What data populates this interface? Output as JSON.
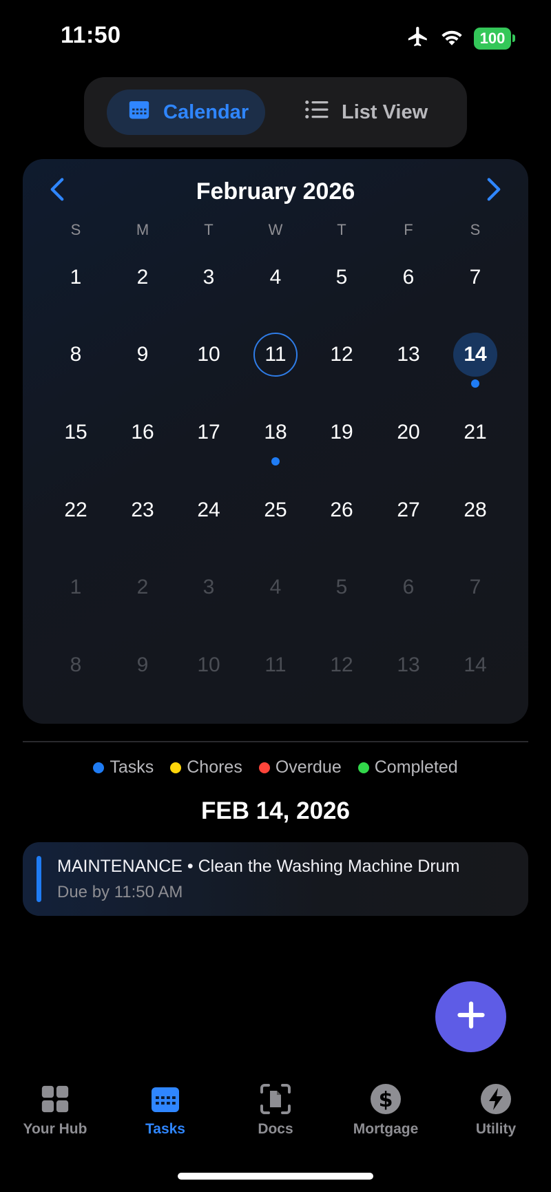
{
  "status_bar": {
    "time": "11:50",
    "battery": "100"
  },
  "view_switch": {
    "calendar_label": "Calendar",
    "list_label": "List View"
  },
  "calendar": {
    "month_title": "February 2026",
    "weekdays": [
      "S",
      "M",
      "T",
      "W",
      "T",
      "F",
      "S"
    ],
    "weeks": [
      [
        "1",
        "2",
        "3",
        "4",
        "5",
        "6",
        "7"
      ],
      [
        "8",
        "9",
        "10",
        "11",
        "12",
        "13",
        "14"
      ],
      [
        "15",
        "16",
        "17",
        "18",
        "19",
        "20",
        "21"
      ],
      [
        "22",
        "23",
        "24",
        "25",
        "26",
        "27",
        "28"
      ],
      [
        "1",
        "2",
        "3",
        "4",
        "5",
        "6",
        "7"
      ],
      [
        "8",
        "9",
        "10",
        "11",
        "12",
        "13",
        "14"
      ]
    ],
    "today": "11",
    "selected": "14",
    "task_dot_days": [
      "14",
      "18"
    ]
  },
  "legend": [
    {
      "label": "Tasks",
      "color": "#1f7cf4"
    },
    {
      "label": "Chores",
      "color": "#ffd60a"
    },
    {
      "label": "Overdue",
      "color": "#ff453a"
    },
    {
      "label": "Completed",
      "color": "#32d74b"
    }
  ],
  "selected_date_label": "FEB 14, 2026",
  "task": {
    "title": "MAINTENANCE • Clean the Washing Machine Drum",
    "due": "Due by 11:50 AM",
    "accent": "#1f7cf4"
  },
  "fab": {
    "icon": "plus-icon"
  },
  "tabs": [
    {
      "label": "Your Hub",
      "icon": "grid-icon",
      "active": false
    },
    {
      "label": "Tasks",
      "icon": "calendar-icon",
      "active": true
    },
    {
      "label": "Docs",
      "icon": "document-scan-icon",
      "active": false
    },
    {
      "label": "Mortgage",
      "icon": "dollar-icon",
      "active": false
    },
    {
      "label": "Utility",
      "icon": "bolt-icon",
      "active": false
    }
  ]
}
